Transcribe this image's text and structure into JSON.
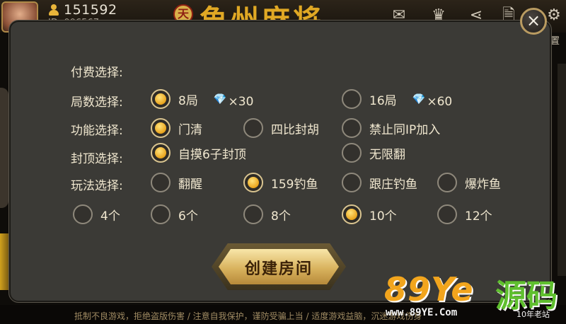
{
  "header": {
    "coins": "151592",
    "user_id": "ID: 006567",
    "logo_seal": "天",
    "logo_title": "魚州麻将",
    "settings_label": "置"
  },
  "dialog": {
    "close_icon": "×",
    "rows": {
      "payment": {
        "label": "付费选择:"
      },
      "rounds": {
        "label": "局数选择:",
        "options": [
          {
            "label": "8局",
            "gem": "×30",
            "selected": true
          },
          {
            "label": "16局",
            "gem": "×60",
            "selected": false
          }
        ]
      },
      "features": {
        "label": "功能选择:",
        "options": [
          {
            "label": "门清",
            "selected": true
          },
          {
            "label": "四比封胡",
            "selected": false
          },
          {
            "label": "禁止同IP加入",
            "selected": false
          }
        ]
      },
      "cap": {
        "label": "封顶选择:",
        "options": [
          {
            "label": "自摸6子封顶",
            "selected": true
          },
          {
            "label": "无限翻",
            "selected": false
          }
        ]
      },
      "play": {
        "label": "玩法选择:",
        "options": [
          {
            "label": "翻醒",
            "selected": false
          },
          {
            "label": "159钓鱼",
            "selected": true
          },
          {
            "label": "跟庄钓鱼",
            "selected": false
          },
          {
            "label": "爆炸鱼",
            "selected": false
          }
        ]
      },
      "count": {
        "options": [
          {
            "label": "4个",
            "selected": false
          },
          {
            "label": "6个",
            "selected": false
          },
          {
            "label": "8个",
            "selected": false
          },
          {
            "label": "10个",
            "selected": true
          },
          {
            "label": "12个",
            "selected": false
          }
        ]
      }
    },
    "create_button": "创建房间"
  },
  "footer": {
    "notice": "抵制不良游戏，拒绝盗版伤害 / 注意自我保护，谨防受骗上当 / 适度游戏益脑，沉迷游戏伤身"
  },
  "watermark": {
    "brand_latin": "89Ye",
    "brand_cn": "源码",
    "url": "www.89YE.Com",
    "tagline": "10年老站"
  },
  "icons": {
    "coin": "person-coin-icon",
    "mail": "mail-icon",
    "crown": "crown-icon",
    "share": "share-icon",
    "doc": "document-icon",
    "settings": "gear-icon",
    "gem": "diamond-icon"
  },
  "colors": {
    "accent_gold": "#e9a41d",
    "dialog_bg": "#3b3a36",
    "text": "#f0e7cf"
  }
}
